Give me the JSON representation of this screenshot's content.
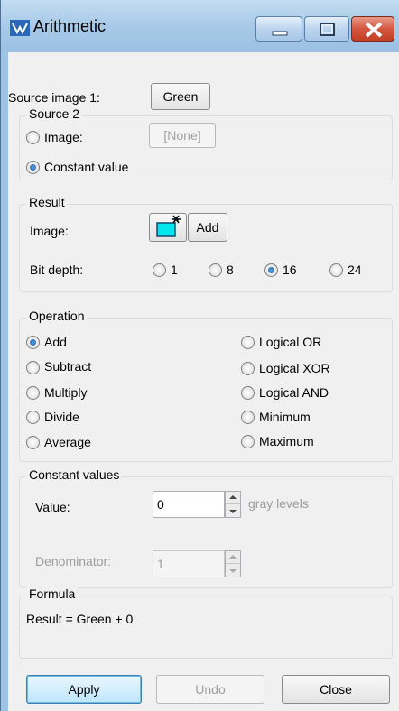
{
  "window": {
    "title": "Arithmetic"
  },
  "source1": {
    "label": "Source image 1:",
    "value": "Green"
  },
  "source2": {
    "group_label": "Source 2",
    "image_label": "Image:",
    "image_value": "[None]",
    "constant_label": "Constant value",
    "selected": "Constant value"
  },
  "result": {
    "group_label": "Result",
    "image_label": "Image:",
    "add_label": "Add",
    "bitdepth_label": "Bit depth:",
    "bitdepth_options": [
      "1",
      "8",
      "16",
      "24"
    ],
    "bitdepth_selected": "16"
  },
  "operation": {
    "group_label": "Operation",
    "options": [
      "Add",
      "Subtract",
      "Multiply",
      "Divide",
      "Average",
      "Logical OR",
      "Logical XOR",
      "Logical AND",
      "Minimum",
      "Maximum"
    ],
    "selected": "Add"
  },
  "constants": {
    "group_label": "Constant values",
    "value_label": "Value:",
    "value": "0",
    "unit": "gray levels",
    "denominator_label": "Denominator:",
    "denominator": "1"
  },
  "formula": {
    "group_label": "Formula",
    "text": "Result = Green + 0"
  },
  "buttons": {
    "apply": "Apply",
    "undo": "Undo",
    "close": "Close"
  }
}
